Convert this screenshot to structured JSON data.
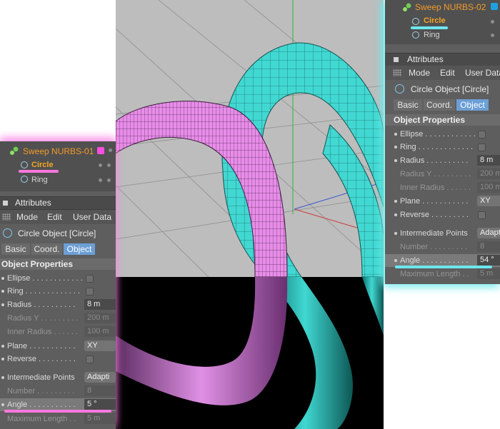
{
  "left_panel": {
    "object_tree": {
      "title": "Sweep NURBS-01",
      "chip_color": "#ff4de3",
      "children": [
        "Circle",
        "Ring"
      ]
    },
    "header": "Attributes",
    "menu": [
      "Mode",
      "Edit",
      "User Data"
    ],
    "object_title": "Circle Object [Circle]",
    "tabs": [
      "Basic",
      "Coord.",
      "Object"
    ],
    "section": "Object Properties",
    "props": {
      "ellipse": "Ellipse . . . . . . . . . . . .",
      "ring": "Ring . . . . . . . . . . . . .",
      "radius": "Radius . . . . . . . . . .",
      "radius_val": "8 m",
      "radius_y": "Radius Y . . . . . . . . .",
      "radius_y_val": "200 m",
      "inner_radius": "Inner Radius . . . . . .",
      "inner_radius_val": "100 m",
      "plane": "Plane . . . . . . . . . . .",
      "plane_val": "XY",
      "reverse": "Reverse . . . . . . . . .",
      "intermediate": "Intermediate Points",
      "intermediate_val": "Adapti",
      "number": "Number . . . . . . . . .",
      "number_val": "8",
      "angle": "Angle . . . . . . . . . . .",
      "angle_val": "5 °",
      "max_length": "Maximum Length . .",
      "max_length_val": "5 m"
    }
  },
  "right_panel": {
    "object_tree": {
      "title": "Sweep NURBS-02",
      "chip_color": "#1fa0e0",
      "children": [
        "Circle",
        "Ring"
      ]
    },
    "header": "Attributes",
    "menu": [
      "Mode",
      "Edit",
      "User Data"
    ],
    "object_title": "Circle Object [Circle]",
    "tabs": [
      "Basic",
      "Coord.",
      "Object"
    ],
    "section": "Object Properties",
    "props": {
      "ellipse": "Ellipse . . . . . . . . . . . .",
      "ring": "Ring . . . . . . . . . . . . .",
      "radius": "Radius . . . . . . . . . .",
      "radius_val": "8 m",
      "radius_y": "Radius Y . . . . . . . . .",
      "radius_y_val": "200 m",
      "inner_radius": "Inner Radius . . . . . .",
      "inner_radius_val": "100 m",
      "plane": "Plane . . . . . . . . . . .",
      "plane_val": "XY",
      "reverse": "Reverse . . . . . . . . .",
      "intermediate": "Intermediate Points",
      "intermediate_val": "Adapt",
      "number": "Number . . . . . . . . .",
      "number_val": "8",
      "angle": "Angle . . . . . . . . . . .",
      "angle_val": "54 °",
      "max_length": "Maximum Length . .",
      "max_length_val": "5 m"
    }
  },
  "viewport": {
    "background_color": "#bcbcbc",
    "render_background": "#000000",
    "ring_colors": {
      "cyan": "#3fd6d0",
      "pink": "#e58ae6"
    }
  }
}
